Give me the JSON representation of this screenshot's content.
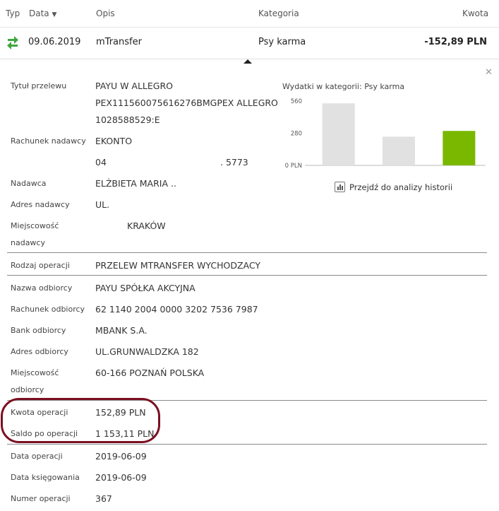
{
  "header": {
    "type": "Typ",
    "date": "Data",
    "desc": "Opis",
    "category": "Kategoria",
    "amount": "Kwota"
  },
  "transaction": {
    "date": "09.06.2019",
    "desc": "mTransfer",
    "category": "Psy karma",
    "amount": "-152,89 PLN"
  },
  "details": {
    "title_label": "Tytuł przelewu",
    "title_lines": [
      "PAYU W ALLEGRO",
      "PEX111560075616276BMGPEX ALLEGRO",
      "1028588529:E"
    ],
    "sender_account_label": "Rachunek nadawcy",
    "sender_account_lines": [
      "EKONTO",
      "04",
      ". 5773"
    ],
    "sender_label": "Nadawca",
    "sender": "ELŻBIETA MARIA ..",
    "sender_address_label": "Adres nadawcy",
    "sender_address": "UL.",
    "sender_city_label_1": "Miejscowość",
    "sender_city_label_2": "nadawcy",
    "sender_city": "KRAKÓW",
    "op_type_label": "Rodzaj operacji",
    "op_type": "PRZELEW MTRANSFER WYCHODZACY",
    "recipient_name_label": "Nazwa odbiorcy",
    "recipient_name": "PAYU SPÓŁKA AKCYJNA",
    "recipient_account_label": "Rachunek odbiorcy",
    "recipient_account": "62 1140 2004 0000 3202 7536 7987",
    "recipient_bank_label": "Bank odbiorcy",
    "recipient_bank": "MBANK S.A.",
    "recipient_address_label": "Adres odbiorcy",
    "recipient_address": "UL.GRUNWALDZKA 182",
    "recipient_city_label_1": "Miejscowość",
    "recipient_city_label_2": "odbiorcy",
    "recipient_city": "60-166 POZNAŃ POLSKA",
    "op_amount_label": "Kwota operacji",
    "op_amount": "152,89 PLN",
    "balance_label": "Saldo po operacji",
    "balance": "1 153,11 PLN",
    "op_date_label": "Data operacji",
    "op_date": "2019-06-09",
    "booking_date_label": "Data księgowania",
    "booking_date": "2019-06-09",
    "op_number_label": "Numer operacji",
    "op_number": "367"
  },
  "chart_title": "Wydatki w kategorii:  Psy karma",
  "chart_link": "Przejdź do analizy historii",
  "colors": {
    "current_bar": "#7ab800",
    "bar": "#e1e1e1",
    "icon_green": "#3fa63f",
    "highlight": "#7a1020"
  },
  "chart_data": {
    "type": "bar",
    "categories": [
      "",
      "",
      ""
    ],
    "values": [
      540,
      250,
      300
    ],
    "y_ticks": [
      "560",
      "280",
      "0 PLN"
    ],
    "ylim": [
      0,
      560
    ],
    "highlight_index": 2
  }
}
